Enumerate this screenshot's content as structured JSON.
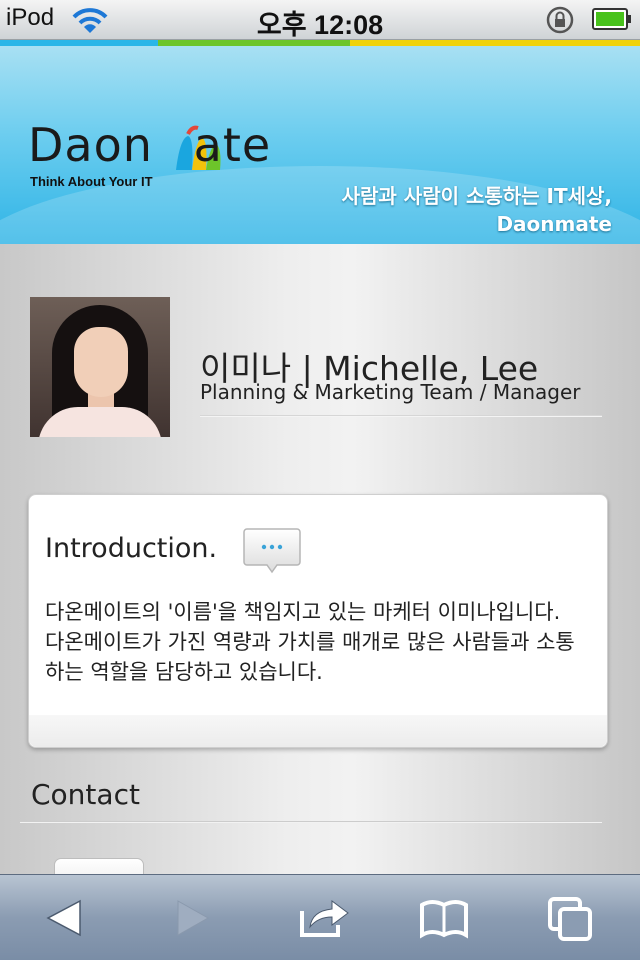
{
  "status_bar": {
    "carrier": "iPod",
    "time": "오후 12:08"
  },
  "colors": {
    "stripe": [
      "#29b6e8",
      "#6dc52a",
      "#f1d20b"
    ],
    "banner_top": "#a8e0f3",
    "banner_bottom": "#2fb4e6",
    "toolbar": "#8b9cb2"
  },
  "banner": {
    "logo_text": "Daon Mate",
    "logo_tagline": "Think About Your IT",
    "slogan_line1": "사람과 사람이 소통하는 IT세상,",
    "slogan_line2": "Daonmate"
  },
  "profile": {
    "name": "이미나 | Michelle, Lee",
    "role": "Planning & Marketing Team / Manager"
  },
  "introduction": {
    "title": "Introduction.",
    "icon": "speech-bubble-icon",
    "body": "다온메이트의 '이름'을 책임지고 있는 마케터 이미나입니다. 다온메이트가 가진 역량과 가치를 매개로 많은 사람들과 소통하는 역할을 담당하고 있습니다."
  },
  "contact": {
    "title": "Contact"
  },
  "toolbar": {
    "icons": [
      "back-icon",
      "forward-icon",
      "share-icon",
      "bookmarks-icon",
      "tabs-icon"
    ]
  }
}
